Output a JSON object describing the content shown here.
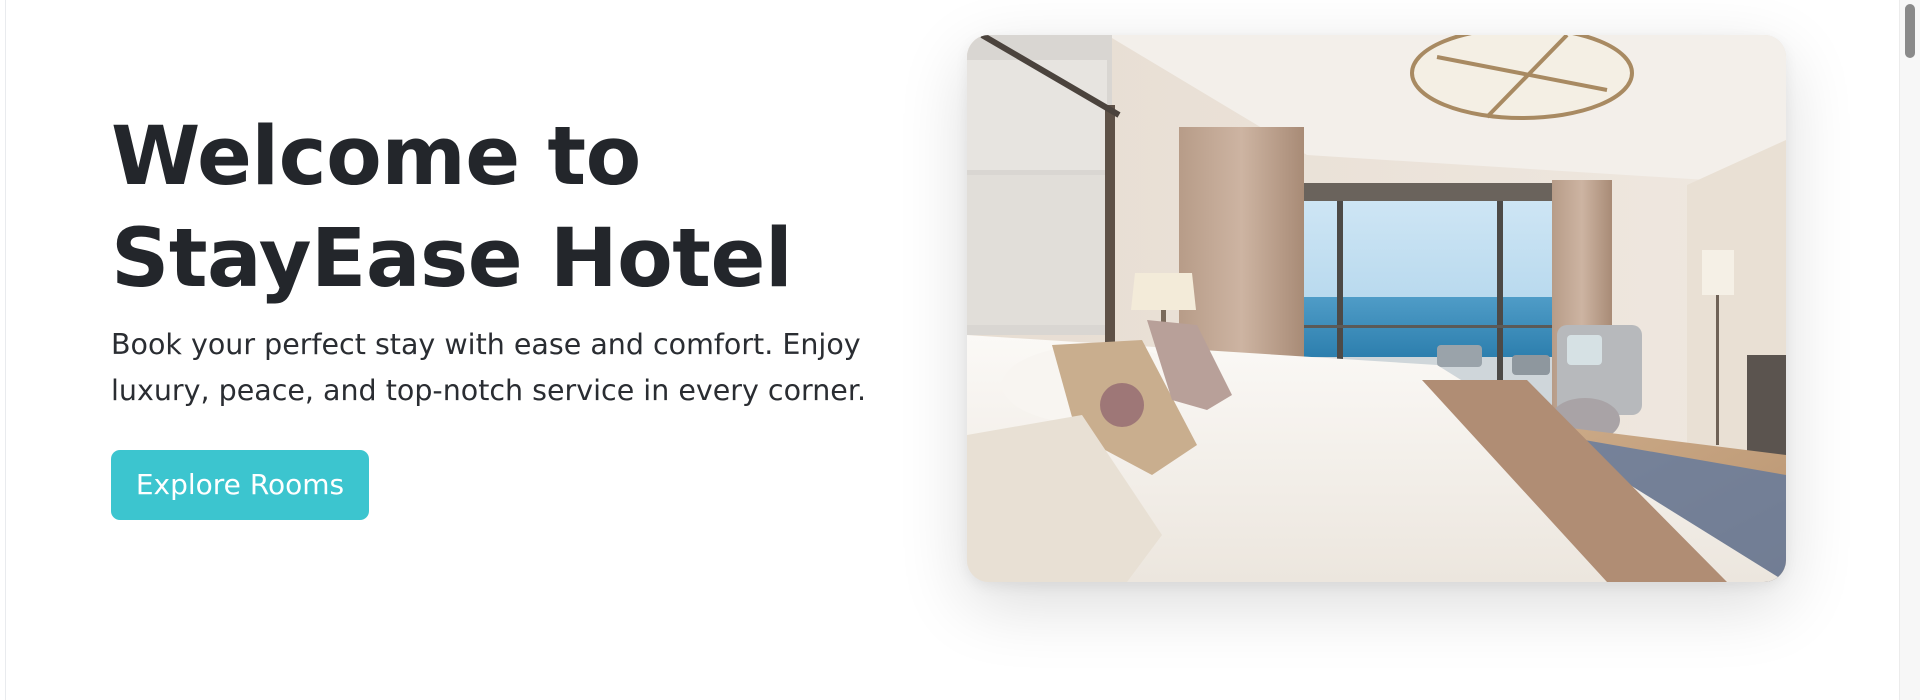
{
  "hero": {
    "title_line1": "Welcome to",
    "title_line2": "StayEase Hotel",
    "subtitle": "Book your perfect stay with ease and comfort. Enjoy luxury, peace, and top-notch service in every corner.",
    "cta_label": "Explore Rooms",
    "image_alt": "Hotel bedroom with ocean view balcony"
  },
  "colors": {
    "accent": "#3cc5cf",
    "heading": "#23262b",
    "background": "#ffffff"
  }
}
